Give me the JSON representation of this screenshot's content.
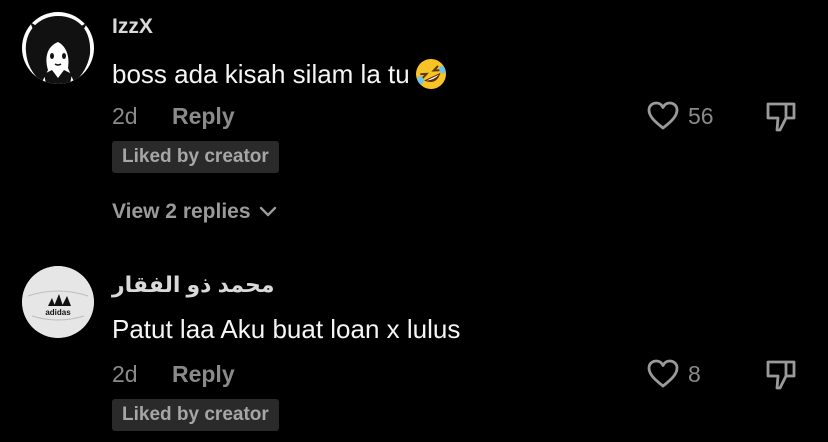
{
  "comments": [
    {
      "username": "IzzX",
      "text": "boss ada kisah silam la tu",
      "emoji": "rolling-on-floor-laughing",
      "age": "2d",
      "reply_label": "Reply",
      "likes": "56",
      "liked_by_creator": "Liked by creator",
      "view_replies": "View 2 replies",
      "avatar": "anime-girl-avatar"
    },
    {
      "username": "محمد ذو الفقار",
      "text": "Patut laa Aku buat loan x lulus",
      "age": "2d",
      "reply_label": "Reply",
      "likes": "8",
      "liked_by_creator": "Liked by creator",
      "avatar": "adidas-ball-avatar"
    }
  ],
  "colors": {
    "background": "#000000",
    "muted_text": "#8a8a8a",
    "badge_bg": "#2a2a2a"
  }
}
